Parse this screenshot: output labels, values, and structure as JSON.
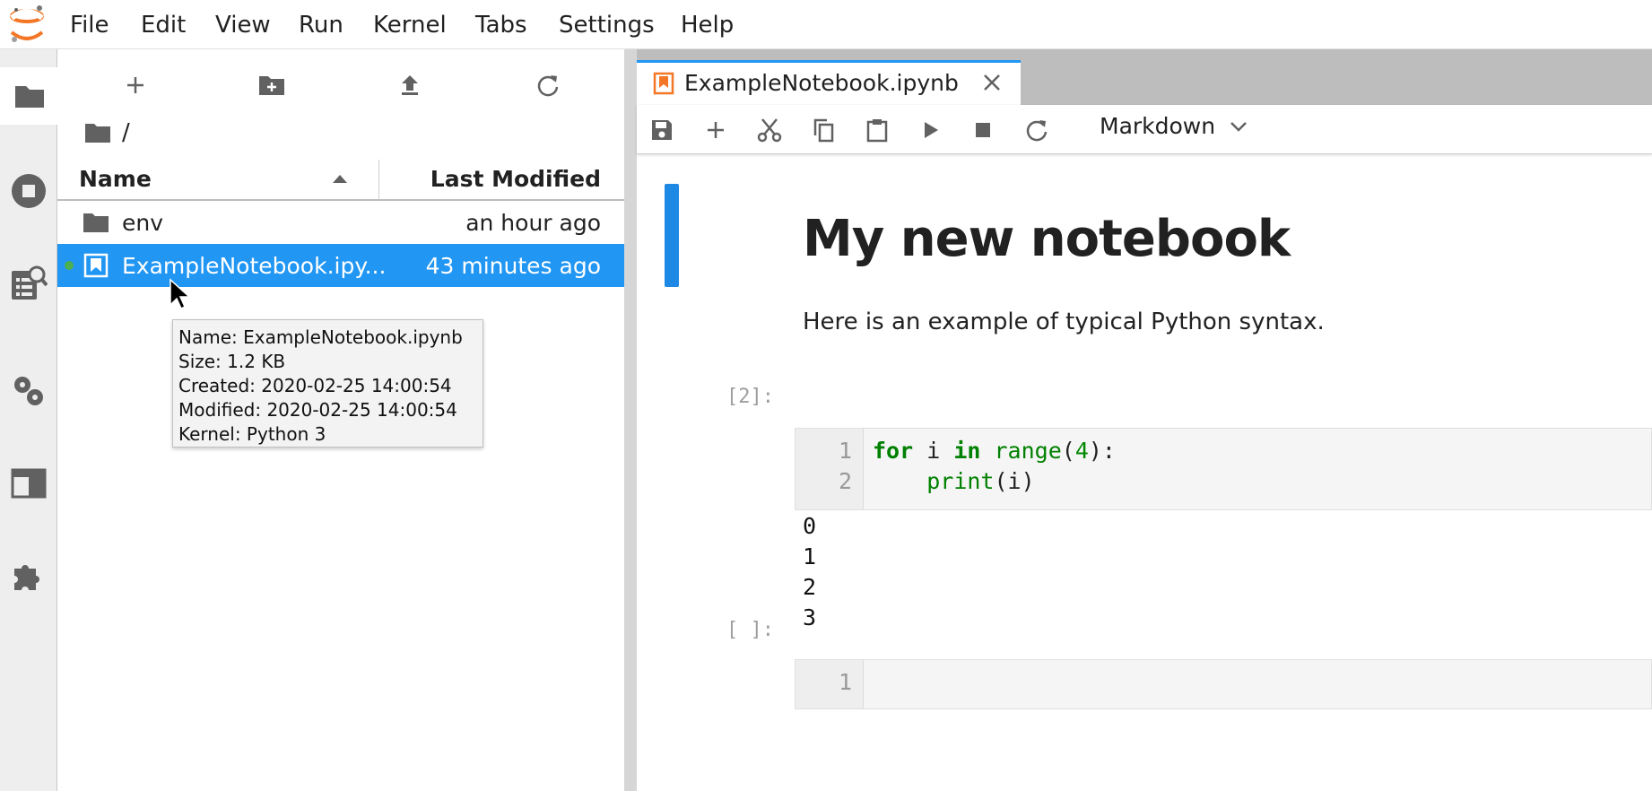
{
  "menubar": {
    "logo": "jupyter-logo",
    "items": [
      "File",
      "Edit",
      "View",
      "Run",
      "Kernel",
      "Tabs",
      "Settings",
      "Help"
    ]
  },
  "activitybar": {
    "items": [
      "folder-icon",
      "running-icon",
      "command-palette-icon",
      "property-inspector-icon",
      "tabs-icon",
      "extension-icon"
    ]
  },
  "filebrowser": {
    "toolbar": [
      "new-launcher-icon",
      "new-folder-icon",
      "upload-icon",
      "refresh-icon"
    ],
    "breadcrumb": "/",
    "columns": {
      "name": "Name",
      "modified": "Last Modified"
    },
    "rows": [
      {
        "name": "env",
        "modified": "an hour ago",
        "type": "folder"
      },
      {
        "name": "ExampleNotebook.ipy...",
        "modified": "43 minutes ago",
        "type": "notebook"
      }
    ],
    "tooltip": {
      "name": "Name: ExampleNotebook.ipynb",
      "size": "Size: 1.2 KB",
      "created": "Created: 2020-02-25 14:00:54",
      "modified": "Modified: 2020-02-25 14:00:54",
      "kernel": "Kernel: Python 3"
    }
  },
  "notebook": {
    "tab": {
      "label": "ExampleNotebook.ipynb"
    },
    "toolbar": {
      "cell_type": "Markdown"
    },
    "markdown": {
      "heading": "My new notebook",
      "paragraph": "Here is an example of typical Python syntax."
    },
    "cells": [
      {
        "prompt": "[2]:",
        "line_numbers": [
          "1",
          "2"
        ]
      },
      {
        "prompt": "[ ]:",
        "line_numbers": [
          "1"
        ]
      }
    ],
    "output": "0\n1\n2\n3"
  },
  "colors": {
    "accent": "#2196f3",
    "running": "#4caf50",
    "logo": "#f37726"
  }
}
